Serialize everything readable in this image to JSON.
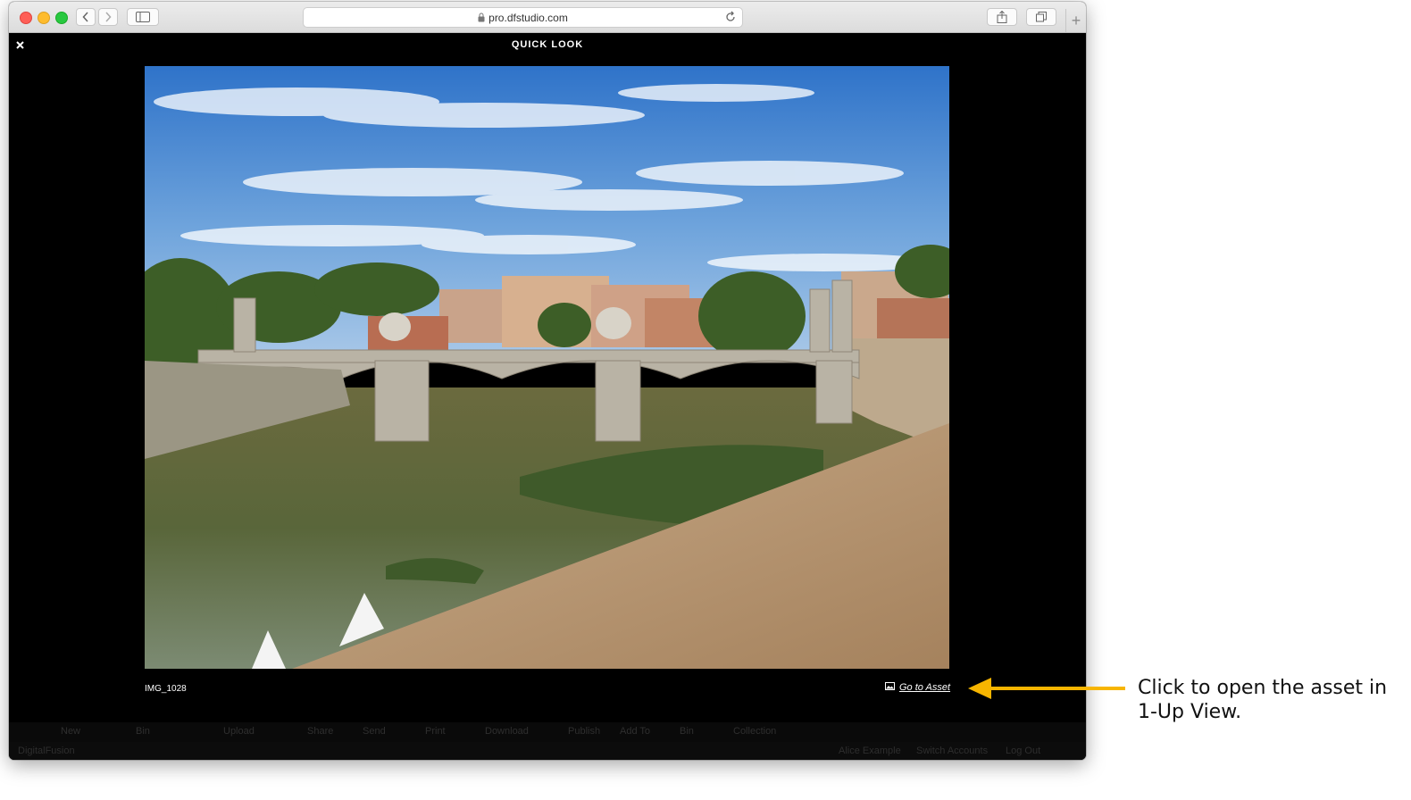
{
  "browser": {
    "url": "pro.dfstudio.com"
  },
  "quicklook": {
    "title": "QUICK LOOK",
    "close_icon": "close-icon",
    "filename": "IMG_1028",
    "go_to_asset": "Go to Asset"
  },
  "background_page": {
    "toolbar": [
      "New",
      "Bin",
      "Upload",
      "Share",
      "Send",
      "Print",
      "Download",
      "Publish",
      "Add To",
      "Bin",
      "Collection"
    ],
    "footer": {
      "brand": "DigitalFusion",
      "user": "Alice Example",
      "switch_accounts": "Switch Accounts",
      "log_out": "Log Out"
    }
  },
  "annotation": {
    "callout": "Click to open the asset in 1-Up View.",
    "arrow_color": "#f7b500"
  }
}
